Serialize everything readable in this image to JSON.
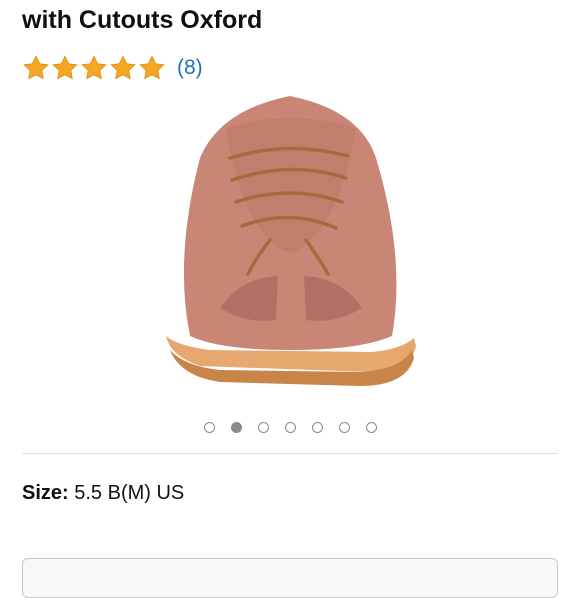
{
  "product": {
    "title_line1": "",
    "title_line2": "with Cutouts Oxford",
    "rating": {
      "stars": 5,
      "max_stars": 5,
      "count_label": "(8)"
    },
    "image": {
      "description_icon": "shoe-image"
    },
    "carousel": {
      "total": 7,
      "active_index": 1
    },
    "size": {
      "label": "Size:",
      "value": "5.5 B(M) US"
    }
  },
  "colors": {
    "star": "#f5a623",
    "link": "#1b72b8",
    "dot": "#8a8a8a"
  }
}
